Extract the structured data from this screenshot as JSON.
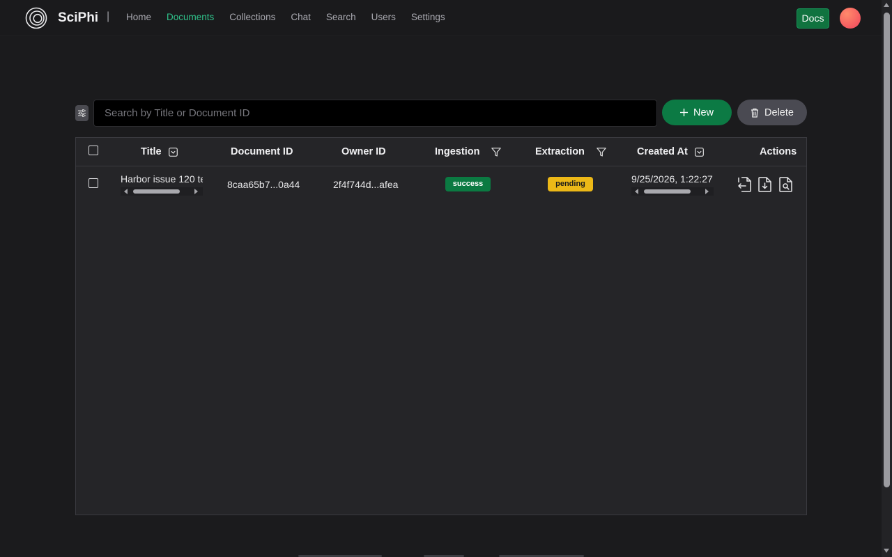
{
  "header": {
    "brand": "SciPhi",
    "separator": "|",
    "nav": [
      {
        "label": "Home",
        "active": false
      },
      {
        "label": "Documents",
        "active": true
      },
      {
        "label": "Collections",
        "active": false
      },
      {
        "label": "Chat",
        "active": false
      },
      {
        "label": "Search",
        "active": false
      },
      {
        "label": "Users",
        "active": false
      },
      {
        "label": "Settings",
        "active": false
      }
    ],
    "docs_label": "Docs",
    "accent": "#2fc28a"
  },
  "toolbar": {
    "search_placeholder": "Search by Title or Document ID",
    "search_value": "",
    "new_label": "New",
    "delete_label": "Delete"
  },
  "table": {
    "columns": {
      "title": "Title",
      "document_id": "Document ID",
      "owner_id": "Owner ID",
      "ingestion": "Ingestion",
      "extraction": "Extraction",
      "created_at": "Created At",
      "actions": "Actions"
    },
    "rows": [
      {
        "title": "Harbor issue 120 te",
        "document_id": "8caa65b7...0a44",
        "owner_id": "2f4f744d...afea",
        "ingestion": "success",
        "extraction": "pending",
        "created_at": "9/25/2026, 1:22:27"
      }
    ]
  },
  "icons": {
    "logo": "sciphi-logo-icon",
    "filter": "sliders-icon",
    "new": "plus-icon",
    "delete": "trash-icon",
    "sort": "chevron-down-square-icon",
    "column_filter": "funnel-icon",
    "actions": [
      "file-update-icon",
      "file-download-icon",
      "file-search-icon"
    ]
  }
}
